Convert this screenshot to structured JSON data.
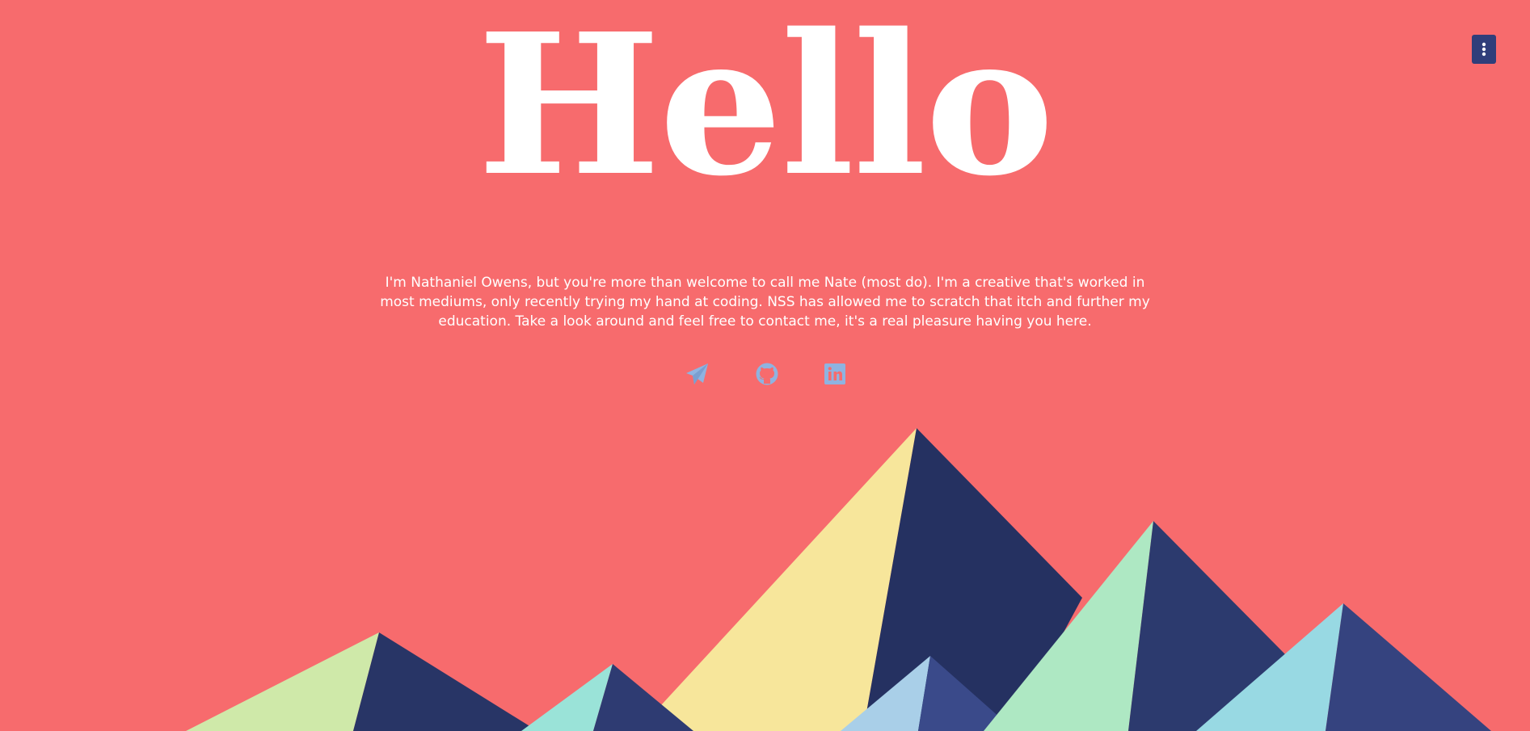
{
  "header": {
    "title": "Hello",
    "menu_icon": "vertical-ellipsis-icon"
  },
  "intro": {
    "text": "I'm Nathaniel Owens, but you're more than welcome to call me Nate (most do). I'm a creative that's worked in most mediums, only recently trying my hand at coding. NSS has allowed me to scratch that itch and further my education. Take a look around and feel free to contact me, it's a real pleasure having you here."
  },
  "social": {
    "icons": [
      "paper-plane-icon",
      "github-icon",
      "linkedin-icon"
    ],
    "icon_color": "#8fb3e0"
  },
  "colors": {
    "background": "#f76b6d",
    "menu_button": "#2f3e7a",
    "title": "#ffffff"
  }
}
